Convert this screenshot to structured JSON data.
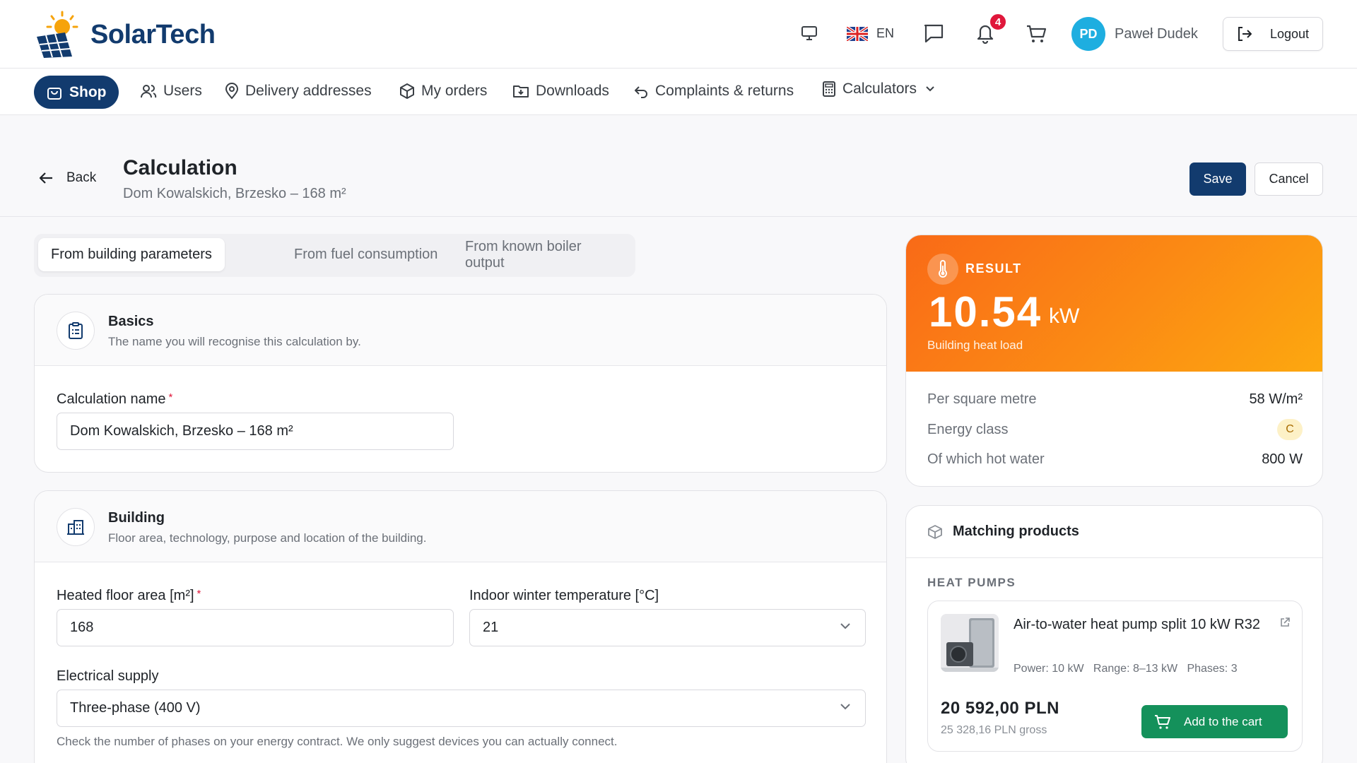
{
  "header": {
    "brand": "SolarTech",
    "language": "EN",
    "notifications_count": "4",
    "user_initials": "PD",
    "user_name": "Paweł Dudek",
    "logout_label": "Logout"
  },
  "nav": {
    "shop": "Shop",
    "items": [
      "Users",
      "Delivery addresses",
      "My orders",
      "Downloads",
      "Complaints & returns",
      "Calculators"
    ]
  },
  "page": {
    "back_label": "Back",
    "title": "Calculation",
    "subtitle": "Dom Kowalskich, Brzesko – 168 m²",
    "save_label": "Save",
    "cancel_label": "Cancel"
  },
  "tabs": [
    "From building parameters",
    "From fuel consumption",
    "From known boiler output"
  ],
  "basics": {
    "title": "Basics",
    "description": "The name you will recognise this calculation by.",
    "name_label": "Calculation name",
    "name_value": "Dom Kowalskich, Brzesko – 168 m²"
  },
  "building": {
    "title": "Building",
    "description": "Floor area, technology, purpose and location of the building.",
    "area_label": "Heated floor area [m²]",
    "area_value": "168",
    "temp_label": "Indoor winter temperature [°C]",
    "temp_value": "21",
    "supply_label": "Electrical supply",
    "supply_value": "Three-phase (400 V)",
    "supply_hint": "Check the number of phases on your energy contract. We only suggest devices you can actually connect."
  },
  "result": {
    "label": "RESULT",
    "value": "10.54",
    "unit": "kW",
    "subtitle": "Building heat load",
    "rows": [
      {
        "key": "Per square metre",
        "value": "58 W/m²"
      },
      {
        "key": "Energy class",
        "value": "C"
      },
      {
        "key": "Of which hot water",
        "value": "800 W"
      }
    ]
  },
  "products": {
    "title": "Matching products",
    "section": "HEAT PUMPS",
    "item": {
      "name": "Air-to-water heat pump split 10 kW R32",
      "specs": "Power: 10 kW   Range: 8–13 kW   Phases: 3",
      "price": "20 592,00 PLN",
      "gross": "25 328,16 PLN gross",
      "cart_label": "Add to the cart"
    }
  },
  "colors": {
    "brand": "#123b6e",
    "result_gradient_start": "#f96a17",
    "result_gradient_end": "#fda80f",
    "cart_green": "#14915b",
    "notification_red": "#e0173b",
    "avatar": "#1eaee0"
  }
}
